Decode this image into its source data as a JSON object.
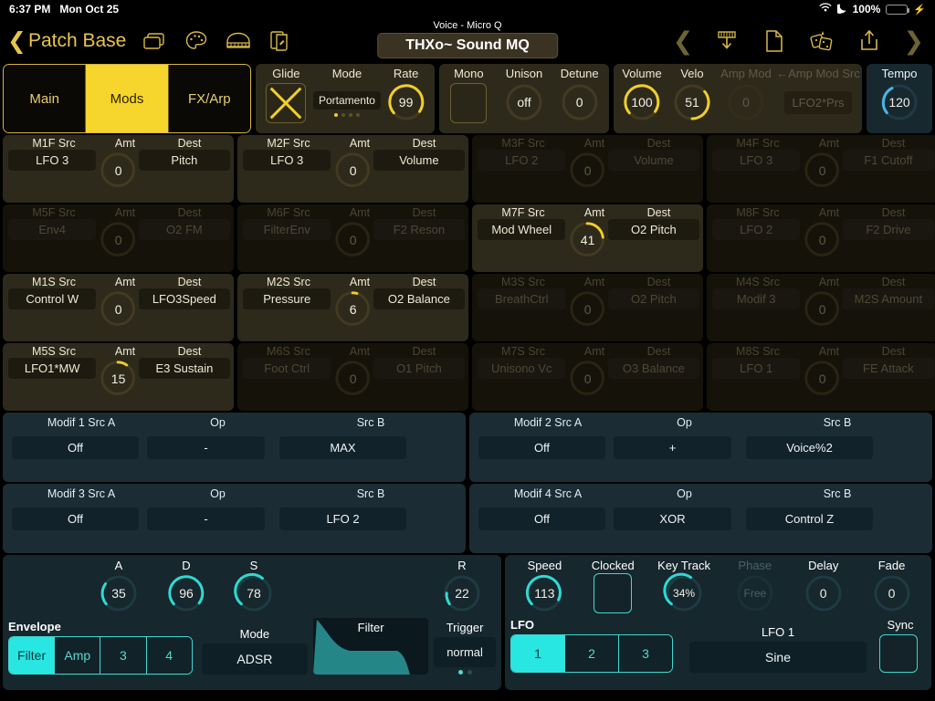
{
  "status_bar": {
    "time": "6:37 PM",
    "date": "Mon Oct 25",
    "battery_pct": "100%"
  },
  "topbar": {
    "back_label": "Patch Base",
    "voice_label": "Voice - Micro Q",
    "patch_name": "THXo~ Sound  MQ",
    "left_icons": [
      "windows-icon",
      "palette-icon",
      "piano-icon",
      "copy-patch-icon"
    ],
    "right_icons": [
      "prev-chevron-icon",
      "download-patch-icon",
      "new-file-icon",
      "randomize-dice-icon",
      "share-upload-icon",
      "next-chevron-icon"
    ]
  },
  "tabs": [
    {
      "label": "Main",
      "active": false
    },
    {
      "label": "Mods",
      "active": true
    },
    {
      "label": "FX/Arp",
      "active": false
    }
  ],
  "global": {
    "glide": {
      "label": "Glide",
      "state": "off-x"
    },
    "mode": {
      "label": "Mode",
      "value": "Portamento",
      "page_dots": 4,
      "page_active": 0
    },
    "rate": {
      "label": "Rate",
      "value": "99",
      "pct": 0.78
    },
    "mono": {
      "label": "Mono",
      "state": "unchecked"
    },
    "unison": {
      "label": "Unison",
      "value": "off",
      "pct": 0
    },
    "detune": {
      "label": "Detune",
      "value": "0",
      "pct": 0
    },
    "volume": {
      "label": "Volume",
      "value": "100",
      "pct": 0.78
    },
    "velo": {
      "label": "Velo",
      "value": "51",
      "pct": 0.4
    },
    "amp_mod": {
      "label": "Amp Mod",
      "value": "0",
      "pct": 0,
      "dim": true
    },
    "amp_mod_src": {
      "label": "←Amp Mod Src",
      "value": "LFO2*Prs",
      "dim": true
    },
    "tempo": {
      "label": "Tempo",
      "value": "120",
      "pct": 0.45
    }
  },
  "matrix": {
    "headers": {
      "src": "Src",
      "amt": "Amt",
      "dest": "Dest"
    },
    "cells": [
      {
        "name": "M1F Src",
        "src": "LFO 3",
        "amt": "0",
        "pct": 0,
        "dest": "Pitch",
        "lit": true
      },
      {
        "name": "M2F Src",
        "src": "LFO 3",
        "amt": "0",
        "pct": 0,
        "dest": "Volume",
        "lit": true
      },
      {
        "name": "M3F Src",
        "src": "LFO 2",
        "amt": "0",
        "pct": 0,
        "dest": "Volume",
        "lit": false
      },
      {
        "name": "M4F Src",
        "src": "LFO 3",
        "amt": "0",
        "pct": 0,
        "dest": "F1 Cutoff",
        "lit": false
      },
      {
        "name": "M5F Src",
        "src": "Env4",
        "amt": "0",
        "pct": 0,
        "dest": "O2 FM",
        "lit": false
      },
      {
        "name": "M6F Src",
        "src": "FilterEnv",
        "amt": "0",
        "pct": 0,
        "dest": "F2 Reson",
        "lit": false
      },
      {
        "name": "M7F Src",
        "src": "Mod Wheel",
        "amt": "41",
        "pct": 0.32,
        "dest": "O2 Pitch",
        "lit": true
      },
      {
        "name": "M8F Src",
        "src": "LFO 2",
        "amt": "0",
        "pct": 0,
        "dest": "F2 Drive",
        "lit": false
      },
      {
        "name": "M1S Src",
        "src": "Control W",
        "amt": "0",
        "pct": 0,
        "dest": "LFO3Speed",
        "lit": true
      },
      {
        "name": "M2S Src",
        "src": "Pressure",
        "amt": "6",
        "pct": 0.05,
        "dest": "O2 Balance",
        "lit": true
      },
      {
        "name": "M3S Src",
        "src": "BreathCtrl",
        "amt": "0",
        "pct": 0,
        "dest": "O2 Pitch",
        "lit": false
      },
      {
        "name": "M4S Src",
        "src": "Modif 3",
        "amt": "0",
        "pct": 0,
        "dest": "M2S Amount",
        "lit": false
      },
      {
        "name": "M5S Src",
        "src": "LFO1*MW",
        "amt": "15",
        "pct": 0.12,
        "dest": "E3 Sustain",
        "lit": true
      },
      {
        "name": "M6S Src",
        "src": "Foot Ctrl",
        "amt": "0",
        "pct": 0,
        "dest": "O1 Pitch",
        "lit": false
      },
      {
        "name": "M7S Src",
        "src": "Unisono Vc",
        "amt": "0",
        "pct": 0,
        "dest": "O3 Balance",
        "lit": false
      },
      {
        "name": "M8S Src",
        "src": "LFO 1",
        "amt": "0",
        "pct": 0,
        "dest": "FE Attack",
        "lit": false
      }
    ]
  },
  "modifiers": {
    "headers": {
      "op": "Op",
      "src_b": "Src B"
    },
    "items": [
      {
        "label": "Modif 1 Src A",
        "src_a": "Off",
        "op": "-",
        "src_b": "MAX"
      },
      {
        "label": "Modif 2 Src A",
        "src_a": "Off",
        "op": "+",
        "src_b": "Voice%2"
      },
      {
        "label": "Modif 3 Src A",
        "src_a": "Off",
        "op": "-",
        "src_b": "LFO 2"
      },
      {
        "label": "Modif 4 Src A",
        "src_a": "Off",
        "op": "XOR",
        "src_b": "Control Z"
      }
    ]
  },
  "envelope": {
    "section_label": "Envelope",
    "knobs": [
      {
        "label": "A",
        "value": "35",
        "pct": 0.28
      },
      {
        "label": "D",
        "value": "96",
        "pct": 0.75
      },
      {
        "label": "S",
        "value": "78",
        "pct": 0.61
      },
      {
        "label": "R",
        "value": "22",
        "pct": 0.17
      }
    ],
    "selector": [
      {
        "label": "Filter",
        "active": true
      },
      {
        "label": "Amp",
        "active": false
      },
      {
        "label": "3",
        "active": false
      },
      {
        "label": "4",
        "active": false
      }
    ],
    "mode_label": "Mode",
    "mode_value": "ADSR",
    "graph_label": "Filter",
    "trigger_label": "Trigger",
    "trigger_value": "normal",
    "page_dots": 2,
    "page_active": 0
  },
  "lfo": {
    "section_label": "LFO",
    "speed": {
      "label": "Speed",
      "value": "113",
      "pct": 0.72
    },
    "clocked": {
      "label": "Clocked",
      "state": "unchecked"
    },
    "key_track": {
      "label": "Key Track",
      "value": "34%",
      "pct": 0.6
    },
    "phase": {
      "label": "Phase",
      "value": "Free",
      "pct": 0,
      "dim": true
    },
    "delay": {
      "label": "Delay",
      "value": "0",
      "pct": 0
    },
    "fade": {
      "label": "Fade",
      "value": "0",
      "pct": 0
    },
    "selector": [
      {
        "label": "1",
        "active": true
      },
      {
        "label": "2",
        "active": false
      },
      {
        "label": "3",
        "active": false
      }
    ],
    "wave_label": "LFO 1",
    "wave_value": "Sine",
    "sync_label": "Sync",
    "sync_state": "unchecked"
  },
  "colors": {
    "gold": "#f0ce2c",
    "cyan": "#28e6e2",
    "panel_gold": "#2e2a1b",
    "panel_blue": "#16272d"
  }
}
